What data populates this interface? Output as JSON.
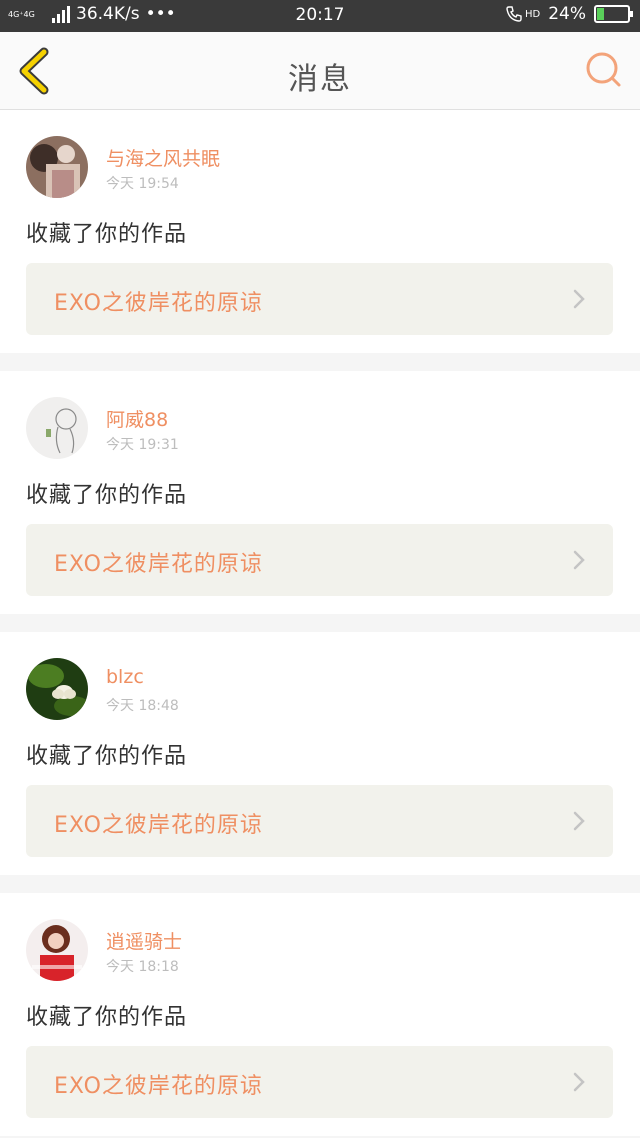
{
  "status_bar": {
    "network": "4G⁺4G",
    "speed": "36.4K/s",
    "dots": "•••",
    "time": "20:17",
    "hd": "HD",
    "battery": "24%",
    "battery_level": 0.24
  },
  "header": {
    "title": "消息"
  },
  "messages": [
    {
      "username": "与海之风共眠",
      "time": "今天 19:54",
      "action": "收藏了你的作品",
      "work_title": "EXO之彼岸花的原谅"
    },
    {
      "username": "阿威88",
      "time": "今天 19:31",
      "action": "收藏了你的作品",
      "work_title": "EXO之彼岸花的原谅"
    },
    {
      "username": "blzc",
      "time": "今天 18:48",
      "action": "收藏了你的作品",
      "work_title": "EXO之彼岸花的原谅"
    },
    {
      "username": "逍遥骑士",
      "time": "今天 18:18",
      "action": "收藏了你的作品",
      "work_title": "EXO之彼岸花的原谅"
    }
  ],
  "colors": {
    "accent": "#ef8f62",
    "back_arrow": "#f5d100",
    "status_bar": "#3a3a3a"
  },
  "icons": {
    "back": "back-arrow-icon",
    "search": "search-icon",
    "chevron": "chevron-right-icon"
  }
}
